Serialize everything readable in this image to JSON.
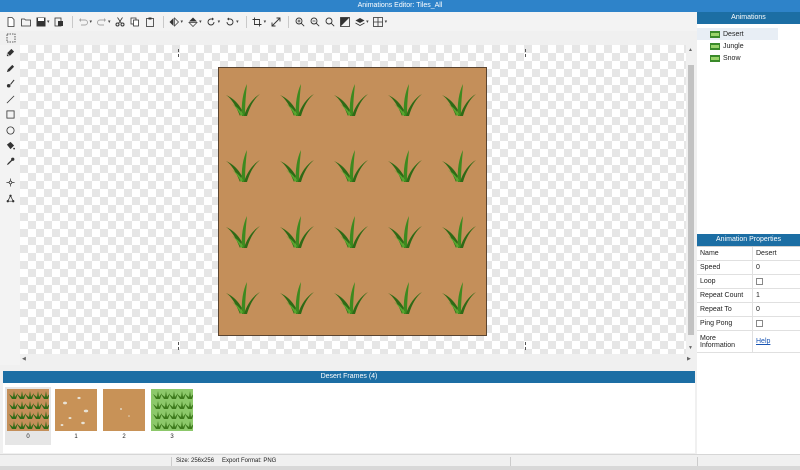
{
  "window": {
    "title": "Animations Editor: Tiles_All"
  },
  "toolbar": {
    "items": [
      "new-file",
      "open-folder",
      "save",
      "export",
      "undo",
      "redo",
      "cut",
      "copy",
      "paste",
      "flip-horizontal",
      "flip-vertical",
      "rotate-left",
      "rotate-right",
      "crop",
      "resize",
      "zoom-in",
      "zoom-out",
      "zoom-fit",
      "adjust",
      "layers",
      "grid"
    ]
  },
  "tools": [
    "select",
    "eraser",
    "pencil",
    "brush",
    "line",
    "rectangle",
    "ellipse",
    "fill",
    "eyedropper",
    "move-point",
    "nodes"
  ],
  "frames": {
    "header": "Desert Frames (4)",
    "items": [
      {
        "index": "0",
        "style": "grass-on-dirt",
        "selected": true
      },
      {
        "index": "1",
        "style": "pebbles"
      },
      {
        "index": "2",
        "style": "plain-dirt"
      },
      {
        "index": "3",
        "style": "grass-green"
      }
    ]
  },
  "animations": {
    "header": "Animations",
    "items": [
      {
        "label": "Desert",
        "selected": true
      },
      {
        "label": "Jungle"
      },
      {
        "label": "Snow"
      }
    ]
  },
  "properties": {
    "header": "Animation Properties",
    "rows": [
      {
        "key": "Name",
        "value": "Desert"
      },
      {
        "key": "Speed",
        "value": "0"
      },
      {
        "key": "Loop",
        "value": "",
        "checkbox": true
      },
      {
        "key": "Repeat Count",
        "value": "1"
      },
      {
        "key": "Repeat To",
        "value": "0"
      },
      {
        "key": "Ping Pong",
        "value": "",
        "checkbox": true
      },
      {
        "key": "More Information",
        "value": "Help",
        "link": true
      }
    ]
  },
  "status": {
    "size": "Size: 256x256",
    "format": "Export Format: PNG"
  },
  "colors": {
    "title_bar": "#2e83c9",
    "panel_header": "#1c6ea4",
    "dirt": "#c48f5a",
    "grass": "#3e7c1c"
  }
}
